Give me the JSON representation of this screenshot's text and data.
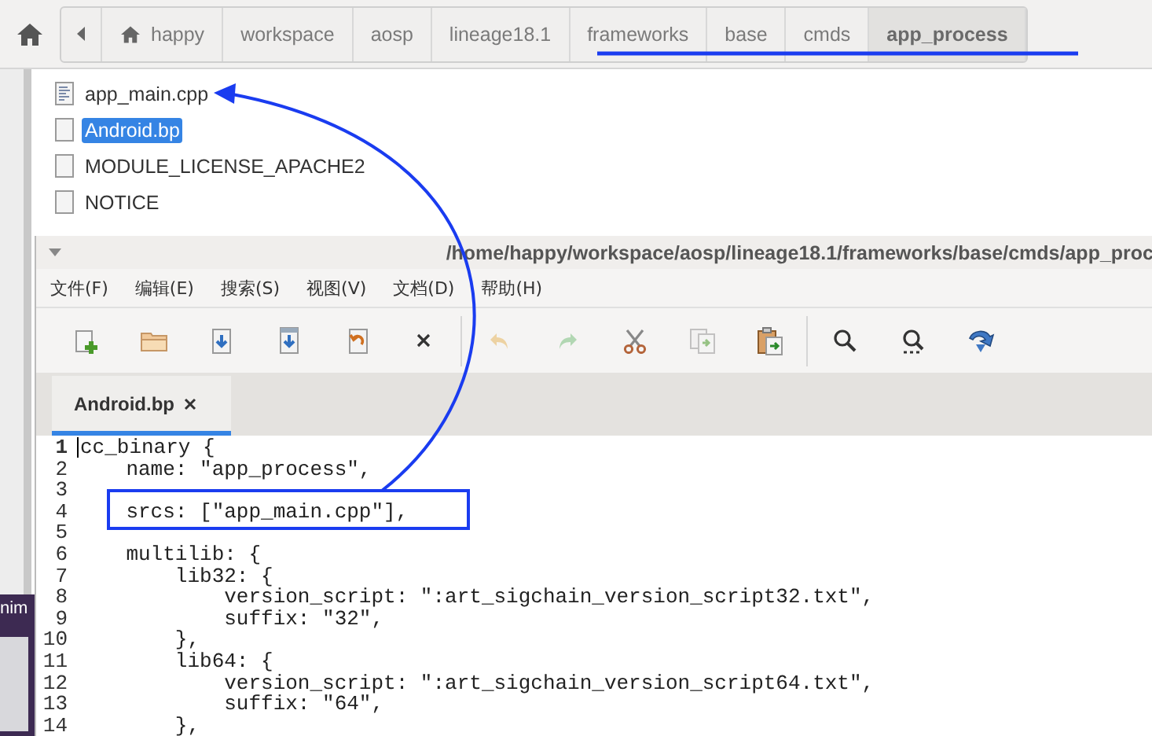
{
  "file_manager": {
    "path_bar": [
      {
        "label": "happy",
        "kind": "home",
        "selected": false
      },
      {
        "label": "workspace",
        "kind": "folder",
        "selected": false
      },
      {
        "label": "aosp",
        "kind": "folder",
        "selected": false
      },
      {
        "label": "lineage18.1",
        "kind": "folder",
        "selected": false
      },
      {
        "label": "frameworks",
        "kind": "folder",
        "selected": false
      },
      {
        "label": "base",
        "kind": "folder",
        "selected": false
      },
      {
        "label": "cmds",
        "kind": "folder",
        "selected": false
      },
      {
        "label": "app_process",
        "kind": "folder",
        "selected": true
      }
    ],
    "files": [
      {
        "name": "app_main.cpp",
        "kind": "text",
        "selected": false
      },
      {
        "name": "Android.bp",
        "kind": "blank",
        "selected": true
      },
      {
        "name": "MODULE_LICENSE_APACHE2",
        "kind": "blank",
        "selected": false
      },
      {
        "name": "NOTICE",
        "kind": "blank",
        "selected": false
      }
    ]
  },
  "background_window": {
    "text": "nim"
  },
  "editor": {
    "title": "/home/happy/workspace/aosp/lineage18.1/frameworks/base/cmds/app_proc",
    "menu": [
      "文件(F)",
      "编辑(E)",
      "搜索(S)",
      "视图(V)",
      "文档(D)",
      "帮助(H)"
    ],
    "toolbar": [
      {
        "kind": "new",
        "disabled": false
      },
      {
        "kind": "open",
        "disabled": false
      },
      {
        "kind": "save",
        "disabled": false
      },
      {
        "kind": "save-as",
        "disabled": false
      },
      {
        "kind": "revert",
        "disabled": false
      },
      {
        "kind": "close",
        "disabled": false
      },
      {
        "kind": "undo",
        "disabled": true
      },
      {
        "kind": "redo",
        "disabled": true
      },
      {
        "kind": "cut",
        "disabled": false
      },
      {
        "kind": "copy",
        "disabled": true
      },
      {
        "kind": "paste",
        "disabled": false
      },
      {
        "kind": "find",
        "disabled": false
      },
      {
        "kind": "find-next",
        "disabled": false
      },
      {
        "kind": "jump",
        "disabled": false
      }
    ],
    "tabs": [
      {
        "label": "Android.bp",
        "selected": true
      }
    ],
    "lines": [
      {
        "number": "1",
        "text": "cc_binary {",
        "current": true
      },
      {
        "number": "2",
        "text": "    name: \"app_process\",",
        "current": false
      },
      {
        "number": "3",
        "current": false
      },
      {
        "number": "4",
        "text": "    srcs: [\"app_main.cpp\"],",
        "current": false
      },
      {
        "number": "5",
        "current": false
      },
      {
        "number": "6",
        "text": "    multilib: {",
        "current": false
      },
      {
        "number": "7",
        "text": "        lib32: {",
        "current": false
      },
      {
        "number": "8",
        "text": "            version_script: \":art_sigchain_version_script32.txt\",",
        "current": false
      },
      {
        "number": "9",
        "text": "            suffix: \"32\",",
        "current": false
      },
      {
        "number": "10",
        "text": "        },",
        "current": false
      },
      {
        "number": "11",
        "text": "        lib64: {",
        "current": false
      },
      {
        "number": "12",
        "text": "            version_script: \":art_sigchain_version_script64.txt\",",
        "current": false
      },
      {
        "number": "13",
        "text": "            suffix: \"64\",",
        "current": false
      },
      {
        "number": "14",
        "text": "        },",
        "current": false
      }
    ]
  }
}
